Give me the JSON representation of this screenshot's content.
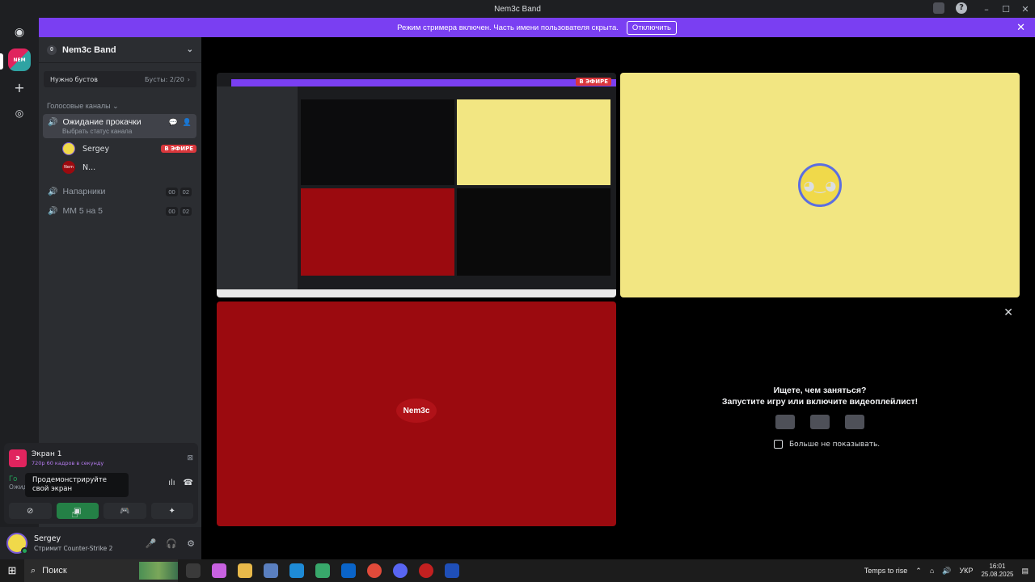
{
  "window": {
    "title": "Nem3c Band"
  },
  "banner": {
    "text": "Режим стримера включен. Часть имени пользователя скрыта.",
    "button": "Отключить"
  },
  "server": {
    "name": "Nem3c Band",
    "boost_label": "Нужно бустов",
    "boost_count": "Бусты: 2/20"
  },
  "voice_category": "Голосовые каналы",
  "channels": {
    "active": {
      "name": "Ожидание прокачки",
      "status": "Выбрать статус канала"
    },
    "members": [
      {
        "name": "Sergey",
        "badge": "В ЭФИРЕ"
      },
      {
        "name": "N..."
      }
    ],
    "others": [
      {
        "name": "Напарники",
        "count_a": "00",
        "count_b": "02"
      },
      {
        "name": "MM 5 на 5",
        "count_a": "00",
        "count_b": "02"
      }
    ]
  },
  "stream_panel": {
    "screen_title": "Экран 1",
    "screen_sub": "720p 60 кадров в секунду",
    "voice_status": "Го",
    "voice_channel": "Ожид",
    "tooltip": "Продемонстрируйте свой экран"
  },
  "user": {
    "name": "Sergey",
    "status": "Стримит Counter-Strike 2"
  },
  "stage": {
    "live_badge": "В ЭФИРЕ",
    "logo_text": "Nem3c",
    "empty_q1": "Ищете, чем заняться?",
    "empty_q2": "Запустите игру или включите видеоплейлист!",
    "dont_show": "Больше не показывать."
  },
  "taskbar": {
    "search": "Поиск",
    "weather": "Temps to rise",
    "lang": "УКР",
    "time": "16:01",
    "date": "25.08.2025"
  }
}
